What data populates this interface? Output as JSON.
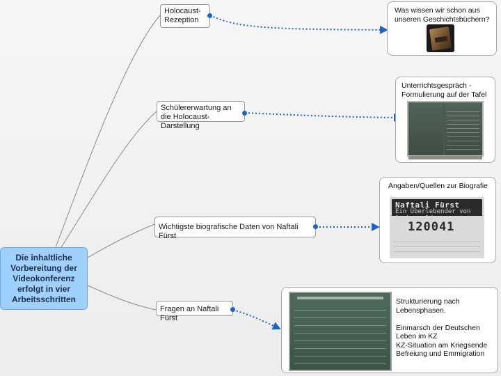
{
  "root": {
    "label": "Die inhaltliche Vorbereitung der Videokonferenz erfolgt in vier Arbeitsschritten"
  },
  "branches": [
    {
      "label": "Holocaust-Rezeption",
      "card_caption": "Was wissen wir schon aus unseren Geschichtsbüchern?"
    },
    {
      "label": "Schülererwartung an die Holocaust-Darstellung",
      "card_caption": "Unterrichtsgespräch - Formulierung auf der Tafel"
    },
    {
      "label": "Wichtigste biografische Daten von Naftali Fürst",
      "card_caption": "Angaben/Quellen zur Biografie"
    },
    {
      "label": "Fragen an Naftali Fürst",
      "card_caption": "Strukturierung nach Lebensphasen.\n\nEinmarsch der Deutschen\nLeben im KZ\nKZ-Situation am Kriegsende\nBefreiung und Emmigration"
    }
  ],
  "document_scan": {
    "name": "Naftali Fürst",
    "subtitle": "Ein Überlebender von Buchenwald",
    "number": "120041"
  },
  "colors": {
    "root_fill": "#9fd0ff",
    "handle": "#1f63c9",
    "connector_dotted": "#1f63c9",
    "connector_tree": "#8a8a8a"
  },
  "icons": [
    "book-icon",
    "blackboard-image",
    "document-scan-image",
    "chalkboard-notes-image"
  ]
}
